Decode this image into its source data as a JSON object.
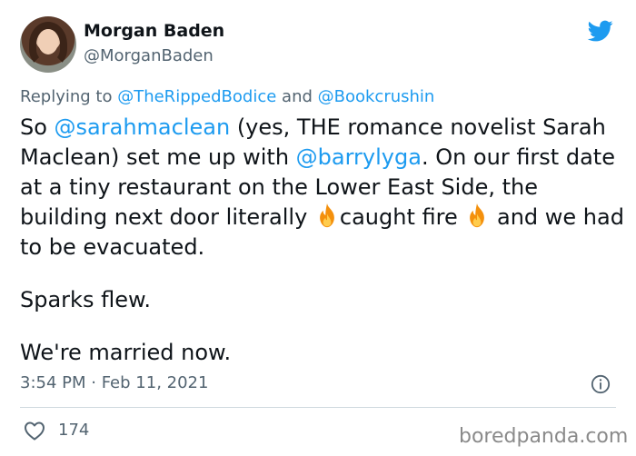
{
  "author": {
    "name": "Morgan Baden",
    "handle": "@MorganBaden"
  },
  "reply": {
    "prefix": "Replying to ",
    "to1": "@TheRippedBodice",
    "and": " and ",
    "to2": "@Bookcrushin"
  },
  "tweet": {
    "t1": "So ",
    "m1": "@sarahmaclean",
    "t2": " (yes, THE romance novelist Sarah Maclean) set me up with ",
    "m2": "@barrylyga",
    "t3": ". On our first date at a tiny restaurant on the Lower East Side, the building next door literally ",
    "t4": "caught fire ",
    "t5": "  and we had to be evacuated.",
    "p2": "Sparks flew.",
    "p3": "We're married now."
  },
  "meta": {
    "timestamp": "3:54 PM · Feb 11, 2021",
    "likes": "174"
  },
  "watermark": "boredpanda.com",
  "icons": {
    "bird": "twitter-bird-icon",
    "fire": "fire-emoji-icon",
    "info": "info-icon",
    "like": "heart-icon"
  },
  "colors": {
    "twitter_blue": "#1d9bf0",
    "secondary_text": "#536471",
    "primary_text": "#0f1419"
  }
}
